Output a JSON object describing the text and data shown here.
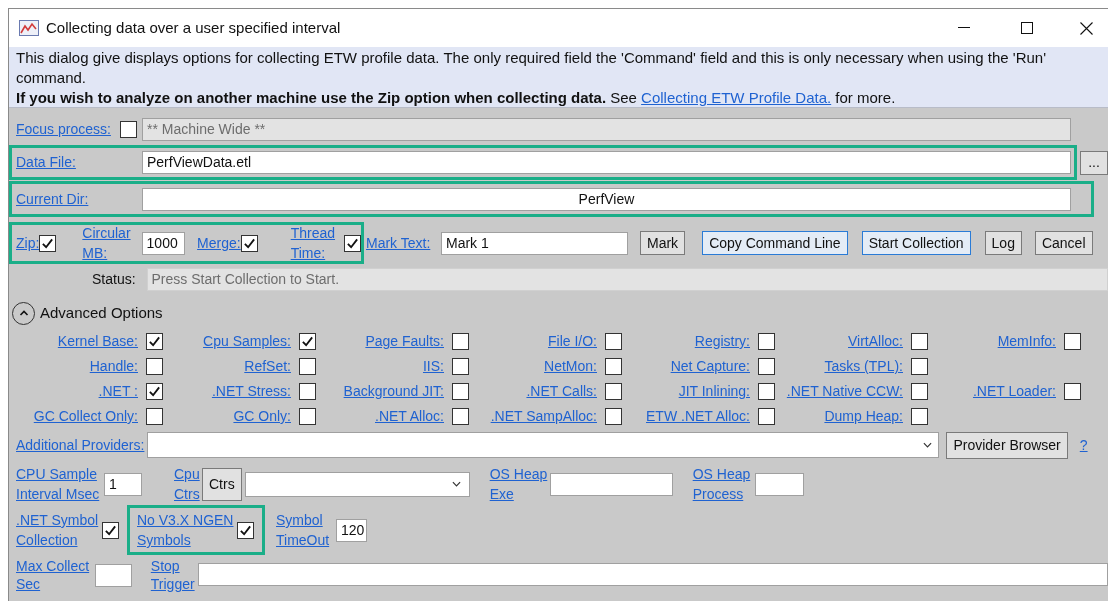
{
  "window": {
    "title": "Collecting data over a user specified interval"
  },
  "info": {
    "text": "This dialog give displays options for collecting ETW profile data. The only required field the 'Command' field and this is only necessary when using the 'Run' command.",
    "note": "**If you wish to analyze on another machine use the Zip option when collecting data.** See ",
    "link": "Collecting ETW Profile Data.",
    "note_end": " for more."
  },
  "focus_process": {
    "label": "Focus process:",
    "checked": false,
    "value": "** Machine Wide **",
    "disabled": true
  },
  "data_file": {
    "label": "Data File:",
    "value": "PerfViewData.etl",
    "highlighted": true,
    "browse_button": "..."
  },
  "current_dir": {
    "label": "Current Dir:",
    "value": "PerfView",
    "highlighted": true
  },
  "collection_options": {
    "highlighted": true,
    "items": [
      {
        "kind": "checkbox",
        "label": "Zip:",
        "checked": true
      },
      {
        "kind": "number",
        "label": "Circular MB:",
        "value": "1000"
      },
      {
        "kind": "checkbox",
        "label": "Merge:",
        "checked": true
      },
      {
        "kind": "checkbox",
        "label": "Thread Time:",
        "checked": true
      }
    ]
  },
  "mark_text": {
    "label": "Mark Text:",
    "value": "Mark 1"
  },
  "buttons": [
    {
      "label": "Mark",
      "highlighted": false
    },
    {
      "label": "Copy Command Line",
      "highlighted": true
    },
    {
      "label": "Start Collection",
      "highlighted": true
    },
    {
      "label": "Log",
      "highlighted": false
    },
    {
      "label": "Cancel",
      "highlighted": false
    }
  ],
  "status": {
    "label": "Status:",
    "value": "Press Start Collection to Start.",
    "disabled": true
  },
  "advanced": {
    "label": "Advanced Options",
    "expanded": true,
    "rows": [
      [
        {
          "label": "Kernel Base:",
          "checked": true
        },
        {
          "label": "Cpu Samples:",
          "checked": true
        },
        {
          "label": "Page Faults:",
          "checked": false
        },
        {
          "label": "File I/O:",
          "checked": false
        },
        {
          "label": "Registry:",
          "checked": false
        },
        {
          "label": "VirtAlloc:",
          "checked": false
        },
        {
          "label": "MemInfo:",
          "checked": false
        }
      ],
      [
        {
          "label": "Handle:",
          "checked": false
        },
        {
          "label": "RefSet:",
          "checked": false
        },
        {
          "label": "IIS:",
          "checked": false
        },
        {
          "label": "NetMon:",
          "checked": false
        },
        {
          "label": "Net Capture:",
          "checked": false
        },
        {
          "label": "Tasks (TPL):",
          "checked": false
        }
      ],
      [
        {
          "label": ".NET :",
          "checked": true
        },
        {
          "label": ".NET Stress:",
          "checked": false
        },
        {
          "label": "Background JIT:",
          "checked": false
        },
        {
          "label": ".NET Calls:",
          "checked": false
        },
        {
          "label": "JIT Inlining:",
          "checked": false
        },
        {
          "label": ".NET Native CCW:",
          "checked": false
        },
        {
          "label": ".NET Loader:",
          "checked": false
        }
      ],
      [
        {
          "label": "GC Collect Only:",
          "checked": false
        },
        {
          "label": "GC Only:",
          "checked": false
        },
        {
          "label": ".NET Alloc:",
          "checked": false
        },
        {
          "label": ".NET SampAlloc:",
          "checked": false
        },
        {
          "label": "ETW .NET Alloc:",
          "checked": false
        },
        {
          "label": "Dump Heap:",
          "checked": false
        }
      ]
    ]
  },
  "additional_providers": {
    "label": "Additional Providers:",
    "button": "Provider Browser",
    "help_link": "?"
  },
  "cpu_sample_interval": {
    "label": "CPU Sample Interval Msec",
    "value": "1"
  },
  "cpu_ctrs": {
    "label": "Cpu Ctrs",
    "button": "Ctrs"
  },
  "os_heap_exe": {
    "label": "OS Heap Exe"
  },
  "os_heap_process": {
    "label": "OS Heap Process"
  },
  "net_symbol_collection": {
    "label": ".NET Symbol Collection",
    "checked": true
  },
  "no_v3x_ngen_symbols": {
    "label": "No V3.X NGEN Symbols",
    "checked": true,
    "highlighted": true
  },
  "symbol_timeout": {
    "label": "Symbol TimeOut",
    "value": "120"
  },
  "max_collect_sec": {
    "label": "Max Collect Sec"
  },
  "stop_trigger": {
    "label": "Stop Trigger"
  }
}
